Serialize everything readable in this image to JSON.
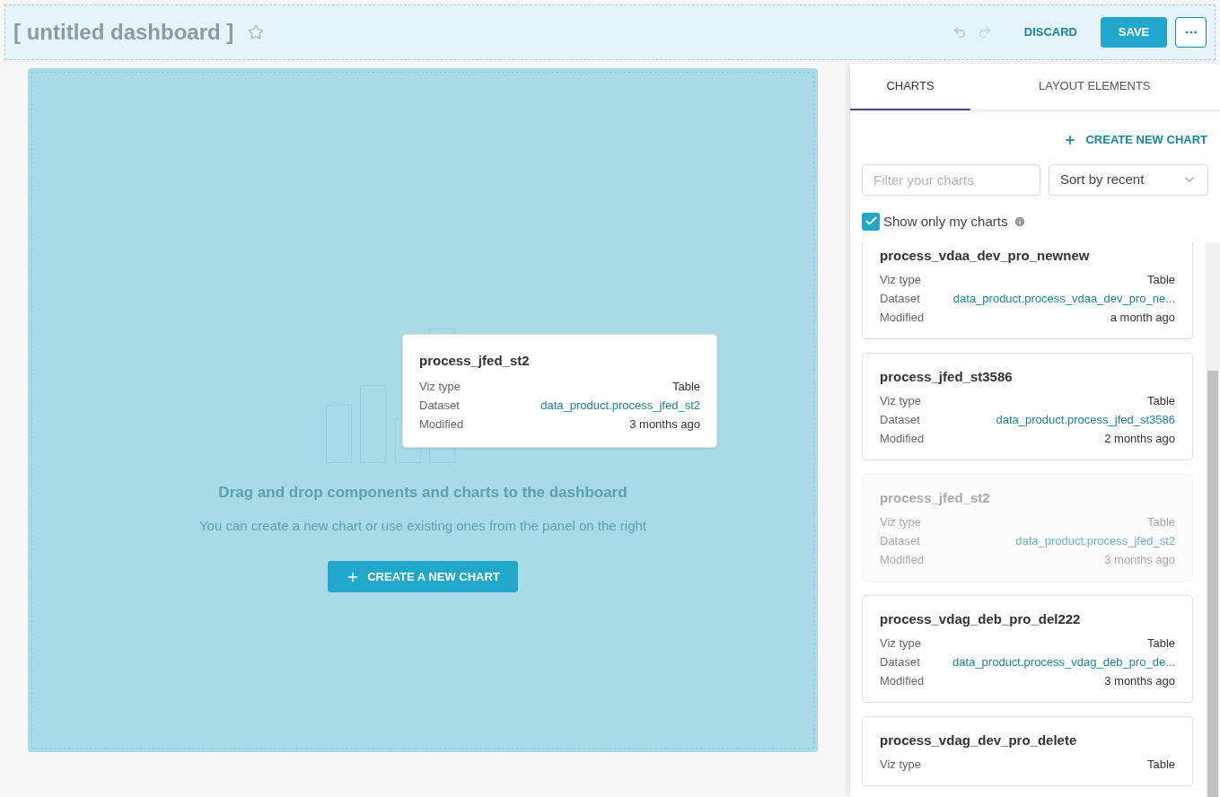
{
  "header": {
    "title": "[ untitled dashboard ]",
    "favorite": false,
    "undo_enabled": false,
    "redo_enabled": false,
    "discard": "DISCARD",
    "save": "SAVE"
  },
  "canvas": {
    "empty_title": "Drag and drop components and charts to the dashboard",
    "empty_text": "You can create a new chart or use existing ones from the panel on the right",
    "create_button": "CREATE A NEW CHART"
  },
  "dragged_card": {
    "title": "process_jfed_st2",
    "rows": [
      {
        "label": "Viz type",
        "value": "Table",
        "kind": "text"
      },
      {
        "label": "Dataset",
        "value": "data_product.process_jfed_st2",
        "kind": "link"
      },
      {
        "label": "Modified",
        "value": "3 months ago",
        "kind": "text"
      }
    ]
  },
  "panel": {
    "tabs": [
      {
        "label": "CHARTS",
        "selected": true
      },
      {
        "label": "LAYOUT ELEMENTS",
        "selected": false
      }
    ],
    "create_link": "CREATE NEW CHART",
    "filter": {
      "placeholder": "Filter your charts"
    },
    "sort": {
      "value": "Sort by recent"
    },
    "show_mine": {
      "label": "Show only my charts",
      "checked": true
    },
    "charts": [
      {
        "title": "process_vdaa_dev_pro_newnew",
        "dragging": false,
        "rows": [
          {
            "label": "Viz type",
            "value": "Table",
            "kind": "text"
          },
          {
            "label": "Dataset",
            "value": "data_product.process_vdaa_dev_pro_ne...",
            "kind": "link"
          },
          {
            "label": "Modified",
            "value": "a month ago",
            "kind": "text"
          }
        ]
      },
      {
        "title": "process_jfed_st3586",
        "dragging": false,
        "rows": [
          {
            "label": "Viz type",
            "value": "Table",
            "kind": "text"
          },
          {
            "label": "Dataset",
            "value": "data_product.process_jfed_st3586",
            "kind": "link"
          },
          {
            "label": "Modified",
            "value": "2 months ago",
            "kind": "text"
          }
        ]
      },
      {
        "title": "process_jfed_st2",
        "dragging": true,
        "rows": [
          {
            "label": "Viz type",
            "value": "Table",
            "kind": "text"
          },
          {
            "label": "Dataset",
            "value": "data_product.process_jfed_st2",
            "kind": "link"
          },
          {
            "label": "Modified",
            "value": "3 months ago",
            "kind": "text"
          }
        ]
      },
      {
        "title": "process_vdag_deb_pro_del222",
        "dragging": false,
        "rows": [
          {
            "label": "Viz type",
            "value": "Table",
            "kind": "text"
          },
          {
            "label": "Dataset",
            "value": "data_product.process_vdag_deb_pro_de...",
            "kind": "link"
          },
          {
            "label": "Modified",
            "value": "3 months ago",
            "kind": "text"
          }
        ]
      },
      {
        "title": "process_vdag_dev_pro_delete",
        "dragging": false,
        "rows": [
          {
            "label": "Viz type",
            "value": "Table",
            "kind": "text"
          }
        ]
      }
    ]
  }
}
